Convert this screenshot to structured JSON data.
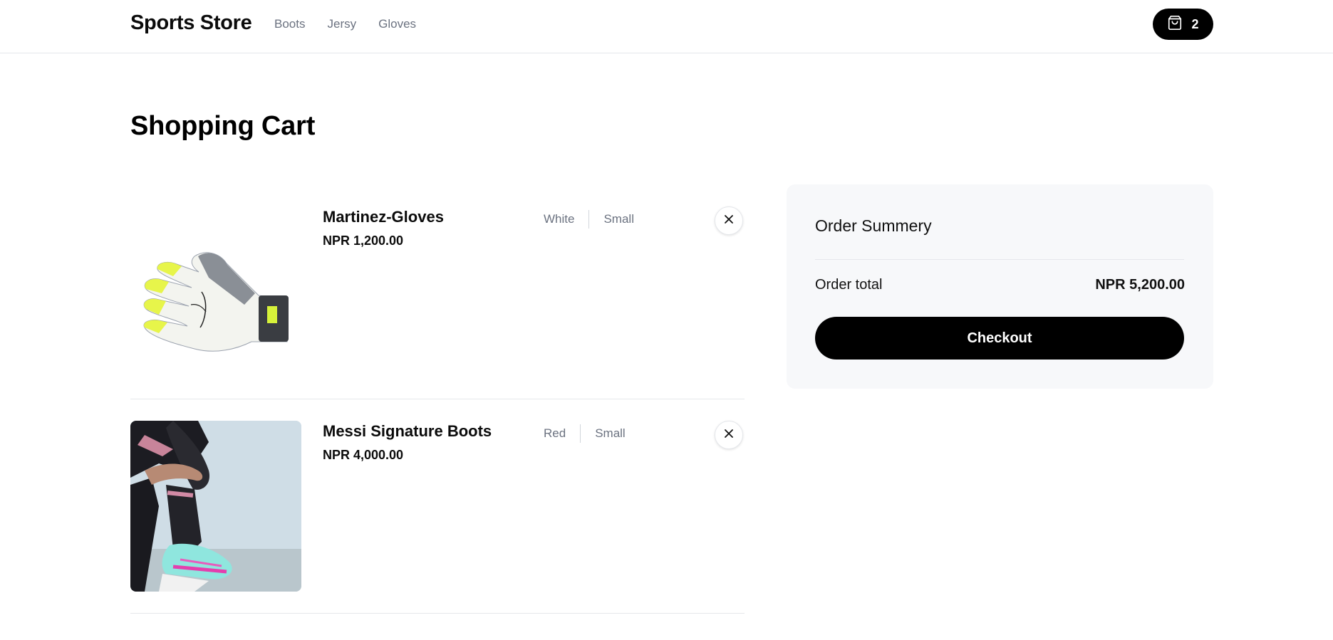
{
  "header": {
    "brand": "Sports Store",
    "nav": [
      {
        "label": "Boots"
      },
      {
        "label": "Jersy"
      },
      {
        "label": "Gloves"
      }
    ],
    "cart_count": "2",
    "cart_icon": "shopping-bag-icon"
  },
  "page": {
    "title": "Shopping Cart"
  },
  "cart": {
    "items": [
      {
        "name": "Martinez-Gloves",
        "price": "NPR 1,200.00",
        "color": "White",
        "size": "Small",
        "image": "goalkeeper-glove-image"
      },
      {
        "name": "Messi Signature Boots",
        "price": "NPR 4,000.00",
        "color": "Red",
        "size": "Small",
        "image": "football-boots-player-image"
      }
    ]
  },
  "summary": {
    "title": "Order Summery",
    "total_label": "Order total",
    "total_value": "NPR 5,200.00",
    "checkout_label": "Checkout"
  },
  "colors": {
    "accent": "#000000",
    "muted_text": "#6b7280",
    "summary_bg": "#f7f8fa",
    "divider": "#e5e7eb"
  }
}
